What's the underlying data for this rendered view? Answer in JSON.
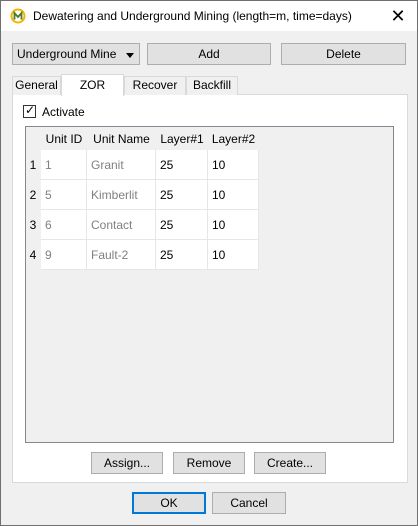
{
  "window": {
    "title": "Dewatering and Underground Mining (length=m, time=days)",
    "close_glyph": "✕"
  },
  "toolbar": {
    "combo_value": "Underground Mine",
    "add_label": "Add",
    "delete_label": "Delete"
  },
  "tabs": [
    {
      "label": "General",
      "active": false
    },
    {
      "label": "ZOR",
      "active": true
    },
    {
      "label": "Recover",
      "active": false
    },
    {
      "label": "Backfill",
      "active": false
    }
  ],
  "activate": {
    "label": "Activate",
    "checked": true
  },
  "grid": {
    "columns": [
      "Unit ID",
      "Unit Name",
      "Layer#1",
      "Layer#2"
    ],
    "rows": [
      {
        "num": "1",
        "unit_id": "1",
        "unit_name": "Granit",
        "layer1": "25",
        "layer2": "10"
      },
      {
        "num": "2",
        "unit_id": "5",
        "unit_name": "Kimberlit",
        "layer1": "25",
        "layer2": "10"
      },
      {
        "num": "3",
        "unit_id": "6",
        "unit_name": "Contact",
        "layer1": "25",
        "layer2": "10"
      },
      {
        "num": "4",
        "unit_id": "9",
        "unit_name": "Fault-2",
        "layer1": "25",
        "layer2": "10"
      }
    ]
  },
  "grid_buttons": {
    "assign_label": "Assign...",
    "remove_label": "Remove",
    "create_label": "Create..."
  },
  "dialog_buttons": {
    "ok_label": "OK",
    "cancel_label": "Cancel"
  },
  "icons": {
    "app": "app-logo-icon",
    "combo": "chevron-down-icon",
    "check": "checkmark-icon"
  },
  "colors": {
    "accent": "#0078d7",
    "readonly_text": "#808080"
  }
}
